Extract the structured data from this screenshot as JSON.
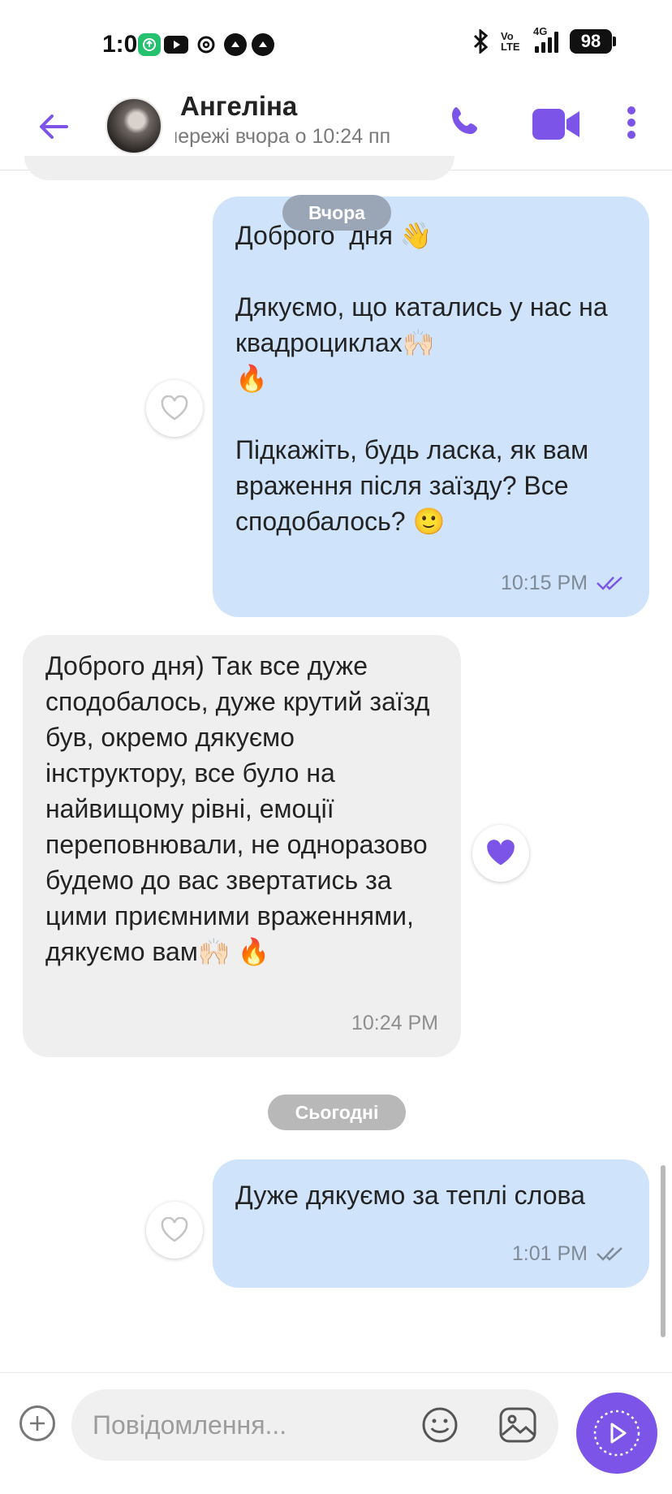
{
  "status_bar": {
    "time": "1:01",
    "network": "4G",
    "volte": "Vo LTE",
    "battery": "98",
    "app_icons": [
      "whatsapp-icon",
      "youtube-icon",
      "threads-icon",
      "notification-icon",
      "notification-icon"
    ]
  },
  "header": {
    "contact_name": "Ангеліна",
    "last_seen": "мережі вчора о 10:24 пп",
    "icons": [
      "back-arrow-icon",
      "phone-icon",
      "video-call-icon",
      "more-vertical-icon"
    ]
  },
  "colors": {
    "accent": "#7c55e8",
    "outgoing_bubble": "#cfe3fb",
    "incoming_bubble": "#efefef",
    "date_pill": "#9aa6b6"
  },
  "chat": {
    "date_yesterday": "Вчора",
    "date_today": "Сьогодні",
    "messages": [
      {
        "direction": "out",
        "text": "Доброго  дня 👋\n\nДякуємо, що катались у нас на квадроциклах🙌🏻\n🔥\n\nПідкажіть, будь ласка, як вам враження після заїзду? Все сподобалось? 🙂",
        "time": "10:15 PM",
        "status": "read",
        "reaction": "empty-heart"
      },
      {
        "direction": "in",
        "text": "Доброго дня) Так все дуже сподобалось, дуже крутий заїзд був, окремо дякуємо інструктору, все було на найвищому рівні, емоції переповнювали, не одноразово будемо до вас звертатись за цими приємними враженнями, дякуємо вам🙌🏻 🔥",
        "time": "10:24 PM",
        "reaction": "filled-heart"
      },
      {
        "direction": "out",
        "text": "Дуже дякуємо за теплі слова",
        "time": "1:01 PM",
        "status": "read",
        "reaction": "empty-heart"
      }
    ]
  },
  "composer": {
    "placeholder": "Повідомлення..."
  }
}
